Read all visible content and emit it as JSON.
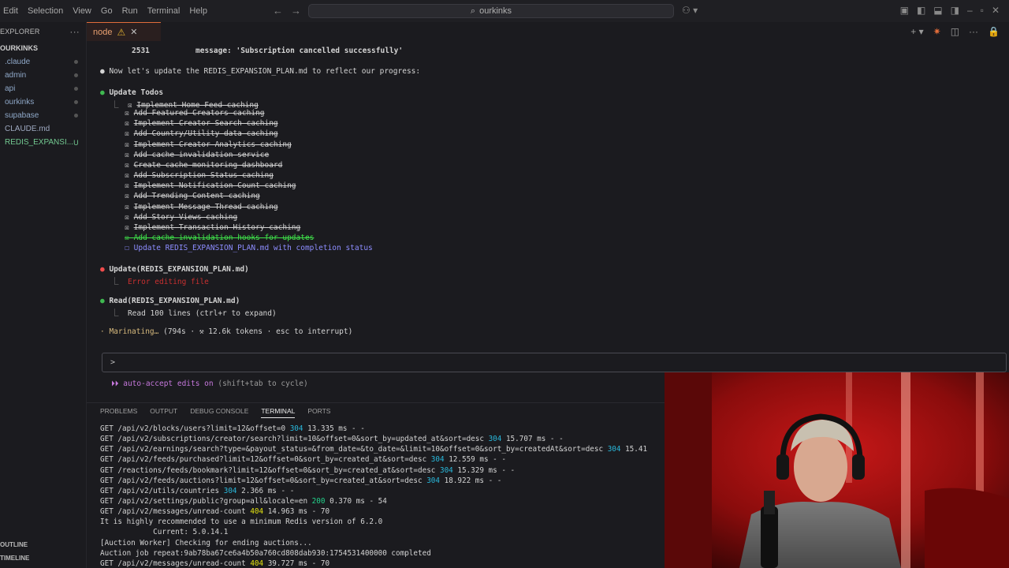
{
  "titlebar": {
    "menu": [
      "Edit",
      "Selection",
      "View",
      "Go",
      "Run",
      "Terminal",
      "Help"
    ],
    "search": "ourkinks"
  },
  "sidebar": {
    "title": "EXPLORER",
    "root": "OURKINKS",
    "items": [
      {
        "label": ".claude",
        "status": "dot"
      },
      {
        "label": "admin",
        "status": "dot"
      },
      {
        "label": "api",
        "status": "dot"
      },
      {
        "label": "ourkinks",
        "status": "dot"
      },
      {
        "label": "supabase",
        "status": "dot"
      },
      {
        "label": "CLAUDE.md",
        "status": ""
      },
      {
        "label": "REDIS_EXPANSI...",
        "status": "U"
      }
    ],
    "outline": "OUTLINE",
    "timeline": "TIMELINE"
  },
  "tab": {
    "label": "node"
  },
  "editor": {
    "line_num": "2531",
    "message": "message: 'Subscription cancelled successfully'",
    "intro": "Now let's update the REDIS_EXPANSION_PLAN.md to reflect our progress:",
    "update_todos": "Update Todos",
    "todos_done": [
      "Implement Home Feed caching",
      "Add Featured Creators caching",
      "Implement Creator Search caching",
      "Add Country/Utility data caching",
      "Implement Creator Analytics caching",
      "Add cache invalidation service",
      "Create cache monitoring dashboard",
      "Add Subscription Status caching",
      "Implement Notification Count caching",
      "Add Trending Content caching",
      "Implement Message Thread caching",
      "Add Story Views caching",
      "Implement Transaction History caching"
    ],
    "todo_active": "Add cache invalidation hooks for updates",
    "todo_pending": "Update REDIS_EXPANSION_PLAN.md with completion status",
    "update_call": "Update(REDIS_EXPANSION_PLAN.md)",
    "update_error": "Error editing file",
    "read_call": "Read(REDIS_EXPANSION_PLAN.md)",
    "read_result": "Read 100 lines (ctrl+r to expand)",
    "status_word": "Marinating…",
    "status_rest": "(794s · ⚒ 12.6k tokens · esc to interrupt)",
    "prompt_symbol": ">",
    "autoaccept": "auto-accept edits on",
    "autoaccept_hint": "(shift+tab to cycle)"
  },
  "panel": {
    "tabs": [
      "PROBLEMS",
      "OUTPUT",
      "DEBUG CONSOLE",
      "TERMINAL",
      "PORTS"
    ],
    "active_tab": "TERMINAL",
    "log": [
      {
        "pre": "GET /api/v2/blocks/users?limit=12&offset=0 ",
        "code": "304",
        "post": " 13.335 ms - -"
      },
      {
        "pre": "GET /api/v2/subscriptions/creator/search?limit=10&offset=0&sort_by=updated_at&sort=desc ",
        "code": "304",
        "post": " 15.707 ms - -"
      },
      {
        "pre": "GET /api/v2/earnings/search?type=&payout_status=&from_date=&to_date=&limit=10&offset=0&sort_by=createdAt&sort=desc ",
        "code": "304",
        "post": " 15.41"
      },
      {
        "pre": "GET /api/v2/feeds/purchased?limit=12&offset=0&sort_by=created_at&sort=desc ",
        "code": "304",
        "post": " 12.559 ms - -"
      },
      {
        "pre": "GET /reactions/feeds/bookmark?limit=12&offset=0&sort_by=created_at&sort=desc ",
        "code": "304",
        "post": " 15.329 ms - -"
      },
      {
        "pre": "GET /api/v2/feeds/auctions?limit=12&offset=0&sort_by=created_at&sort=desc ",
        "code": "304",
        "post": " 18.922 ms - -"
      },
      {
        "pre": "GET /api/v2/utils/countries ",
        "code": "304",
        "post": " 2.366 ms - -"
      },
      {
        "pre": "GET /api/v2/settings/public?group=all&locale=en ",
        "code": "200",
        "post": " 0.370 ms - 54"
      },
      {
        "pre": "GET /api/v2/messages/unread-count ",
        "code": "404",
        "post": " 14.963 ms - 70"
      },
      {
        "pre": "It is highly recommended to use a minimum Redis version of 6.2.0",
        "code": "",
        "post": ""
      },
      {
        "pre": "            Current: 5.0.14.1",
        "code": "",
        "post": ""
      },
      {
        "pre": "[Auction Worker] Checking for ending auctions...",
        "code": "",
        "post": ""
      },
      {
        "pre": "Auction job repeat:9ab78ba67ce6a4b50a760cd808dab930:1754531400000 completed",
        "code": "",
        "post": ""
      },
      {
        "pre": "GET /api/v2/messages/unread-count ",
        "code": "404",
        "post": " 39.727 ms - 70"
      }
    ]
  },
  "colors": {
    "accent_green": "#3fb950",
    "error_red": "#f14c4c",
    "status_304": "#29b8db",
    "status_200": "#23d18b",
    "status_404": "#e5e510"
  }
}
